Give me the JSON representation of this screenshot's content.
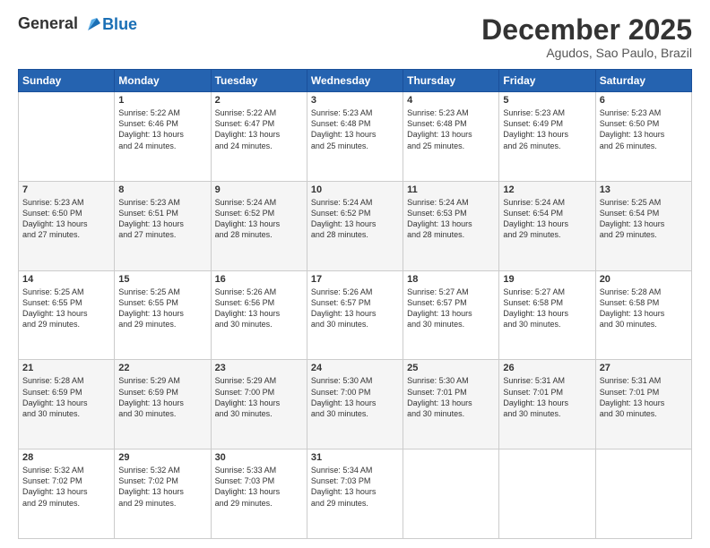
{
  "header": {
    "logo": {
      "line1": "General",
      "line2": "Blue"
    },
    "title": "December 2025",
    "location": "Agudos, Sao Paulo, Brazil"
  },
  "weekdays": [
    "Sunday",
    "Monday",
    "Tuesday",
    "Wednesday",
    "Thursday",
    "Friday",
    "Saturday"
  ],
  "weeks": [
    [
      {
        "day": "",
        "info": ""
      },
      {
        "day": "1",
        "info": "Sunrise: 5:22 AM\nSunset: 6:46 PM\nDaylight: 13 hours\nand 24 minutes."
      },
      {
        "day": "2",
        "info": "Sunrise: 5:22 AM\nSunset: 6:47 PM\nDaylight: 13 hours\nand 24 minutes."
      },
      {
        "day": "3",
        "info": "Sunrise: 5:23 AM\nSunset: 6:48 PM\nDaylight: 13 hours\nand 25 minutes."
      },
      {
        "day": "4",
        "info": "Sunrise: 5:23 AM\nSunset: 6:48 PM\nDaylight: 13 hours\nand 25 minutes."
      },
      {
        "day": "5",
        "info": "Sunrise: 5:23 AM\nSunset: 6:49 PM\nDaylight: 13 hours\nand 26 minutes."
      },
      {
        "day": "6",
        "info": "Sunrise: 5:23 AM\nSunset: 6:50 PM\nDaylight: 13 hours\nand 26 minutes."
      }
    ],
    [
      {
        "day": "7",
        "info": "Sunrise: 5:23 AM\nSunset: 6:50 PM\nDaylight: 13 hours\nand 27 minutes."
      },
      {
        "day": "8",
        "info": "Sunrise: 5:23 AM\nSunset: 6:51 PM\nDaylight: 13 hours\nand 27 minutes."
      },
      {
        "day": "9",
        "info": "Sunrise: 5:24 AM\nSunset: 6:52 PM\nDaylight: 13 hours\nand 28 minutes."
      },
      {
        "day": "10",
        "info": "Sunrise: 5:24 AM\nSunset: 6:52 PM\nDaylight: 13 hours\nand 28 minutes."
      },
      {
        "day": "11",
        "info": "Sunrise: 5:24 AM\nSunset: 6:53 PM\nDaylight: 13 hours\nand 28 minutes."
      },
      {
        "day": "12",
        "info": "Sunrise: 5:24 AM\nSunset: 6:54 PM\nDaylight: 13 hours\nand 29 minutes."
      },
      {
        "day": "13",
        "info": "Sunrise: 5:25 AM\nSunset: 6:54 PM\nDaylight: 13 hours\nand 29 minutes."
      }
    ],
    [
      {
        "day": "14",
        "info": "Sunrise: 5:25 AM\nSunset: 6:55 PM\nDaylight: 13 hours\nand 29 minutes."
      },
      {
        "day": "15",
        "info": "Sunrise: 5:25 AM\nSunset: 6:55 PM\nDaylight: 13 hours\nand 29 minutes."
      },
      {
        "day": "16",
        "info": "Sunrise: 5:26 AM\nSunset: 6:56 PM\nDaylight: 13 hours\nand 30 minutes."
      },
      {
        "day": "17",
        "info": "Sunrise: 5:26 AM\nSunset: 6:57 PM\nDaylight: 13 hours\nand 30 minutes."
      },
      {
        "day": "18",
        "info": "Sunrise: 5:27 AM\nSunset: 6:57 PM\nDaylight: 13 hours\nand 30 minutes."
      },
      {
        "day": "19",
        "info": "Sunrise: 5:27 AM\nSunset: 6:58 PM\nDaylight: 13 hours\nand 30 minutes."
      },
      {
        "day": "20",
        "info": "Sunrise: 5:28 AM\nSunset: 6:58 PM\nDaylight: 13 hours\nand 30 minutes."
      }
    ],
    [
      {
        "day": "21",
        "info": "Sunrise: 5:28 AM\nSunset: 6:59 PM\nDaylight: 13 hours\nand 30 minutes."
      },
      {
        "day": "22",
        "info": "Sunrise: 5:29 AM\nSunset: 6:59 PM\nDaylight: 13 hours\nand 30 minutes."
      },
      {
        "day": "23",
        "info": "Sunrise: 5:29 AM\nSunset: 7:00 PM\nDaylight: 13 hours\nand 30 minutes."
      },
      {
        "day": "24",
        "info": "Sunrise: 5:30 AM\nSunset: 7:00 PM\nDaylight: 13 hours\nand 30 minutes."
      },
      {
        "day": "25",
        "info": "Sunrise: 5:30 AM\nSunset: 7:01 PM\nDaylight: 13 hours\nand 30 minutes."
      },
      {
        "day": "26",
        "info": "Sunrise: 5:31 AM\nSunset: 7:01 PM\nDaylight: 13 hours\nand 30 minutes."
      },
      {
        "day": "27",
        "info": "Sunrise: 5:31 AM\nSunset: 7:01 PM\nDaylight: 13 hours\nand 30 minutes."
      }
    ],
    [
      {
        "day": "28",
        "info": "Sunrise: 5:32 AM\nSunset: 7:02 PM\nDaylight: 13 hours\nand 29 minutes."
      },
      {
        "day": "29",
        "info": "Sunrise: 5:32 AM\nSunset: 7:02 PM\nDaylight: 13 hours\nand 29 minutes."
      },
      {
        "day": "30",
        "info": "Sunrise: 5:33 AM\nSunset: 7:03 PM\nDaylight: 13 hours\nand 29 minutes."
      },
      {
        "day": "31",
        "info": "Sunrise: 5:34 AM\nSunset: 7:03 PM\nDaylight: 13 hours\nand 29 minutes."
      },
      {
        "day": "",
        "info": ""
      },
      {
        "day": "",
        "info": ""
      },
      {
        "day": "",
        "info": ""
      }
    ]
  ]
}
